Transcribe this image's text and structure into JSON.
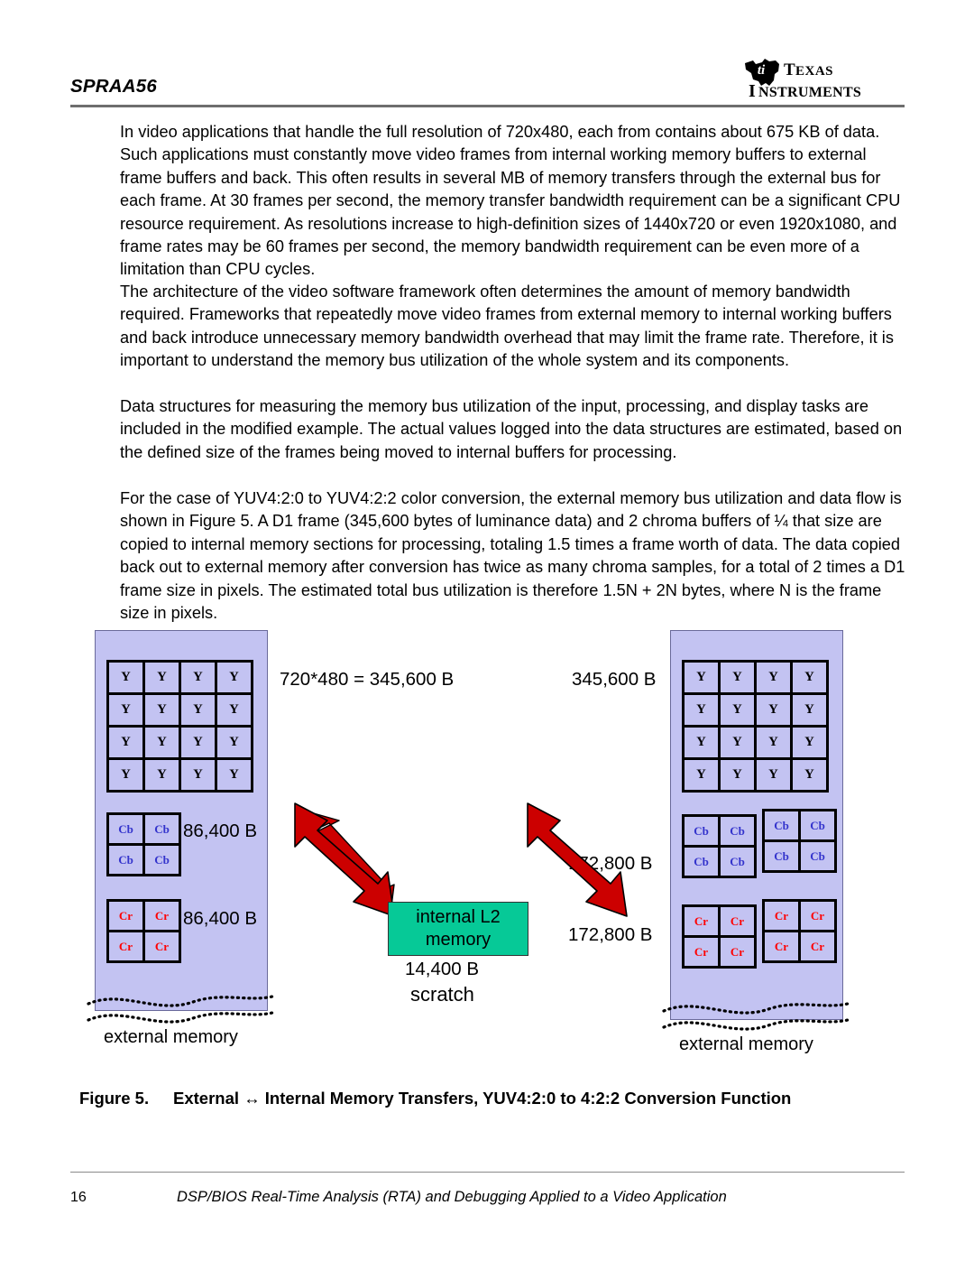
{
  "header": {
    "doc_id": "SPRAA56",
    "logo_line1": "TEXAS",
    "logo_line2": "INSTRUMENTS",
    "logo_mark": "ti"
  },
  "paragraphs": {
    "p1": "In video applications that handle the full resolution of 720x480, each from contains about 675 KB of data. Such applications must constantly move video frames from internal working memory buffers to external frame buffers and back. This often results in several MB of memory transfers through the external bus for each frame. At 30 frames per second, the memory transfer bandwidth requirement can be a significant CPU resource requirement. As resolutions increase to high-definition sizes of 1440x720 or even 1920x1080, and frame rates may be 60 frames per second, the memory bandwidth requirement can be even more of a limitation than CPU cycles.",
    "p2": "The architecture of the video software framework often determines the amount of memory bandwidth required. Frameworks that repeatedly move video frames from external memory to internal working buffers and back introduce unnecessary memory bandwidth overhead that may limit the frame rate. Therefore, it is important to understand the memory bus utilization of the whole system and its components.",
    "p3": "Data structures for measuring the memory bus utilization of the input, processing, and display tasks are included in the modified example. The actual values logged into the data structures are estimated, based on the defined size of the frames being moved to internal buffers for processing.",
    "p4": "For the case of YUV4:2:0 to YUV4:2:2 color conversion, the external memory bus utilization and data flow is shown in Figure 5. A D1 frame (345,600 bytes of luminance data) and 2 chroma buffers of ¼ that size are copied to internal memory sections for processing, totaling 1.5 times a frame worth of data. The data copied back out to external memory after conversion has twice as many chroma samples, for a total of 2 times a D1 frame size in pixels. The estimated total bus utilization is therefore 1.5N + 2N bytes, where N is the frame size in pixels."
  },
  "figure": {
    "left_block": {
      "external_label": "external memory",
      "luma_label": "Y",
      "chroma_b_label": "Cb",
      "chroma_r_label": "Cr",
      "annot_luma": "720*480 = 345,600 B",
      "annot_cb": "86,400 B",
      "annot_cr": "86,400 B"
    },
    "right_block": {
      "external_label": "external memory",
      "luma_label": "Y",
      "chroma_b_label": "Cb",
      "chroma_r_label": "Cr",
      "annot_luma": "345,600 B",
      "annot_cb": "172,800 B",
      "annot_cr": "172,800 B"
    },
    "center": {
      "l2_line1": "internal L2",
      "l2_line2": "memory",
      "scratch_size": "14,400 B",
      "scratch_label": "scratch"
    },
    "colors": {
      "memory_fill": "#c3c3f2",
      "l2_fill": "#06c997",
      "arrow_fill": "#cc0000",
      "luma_text": "#000000",
      "cb_text": "#3333cc",
      "cr_text": "#ff0000"
    }
  },
  "caption": {
    "number": "Figure 5.",
    "text": "External ↔ Internal Memory Transfers, YUV4:2:0 to 4:2:2 Conversion Function"
  },
  "footer": {
    "page_number": "16",
    "title": "DSP/BIOS Real-Time Analysis (RTA) and Debugging Applied to a Video Application"
  }
}
